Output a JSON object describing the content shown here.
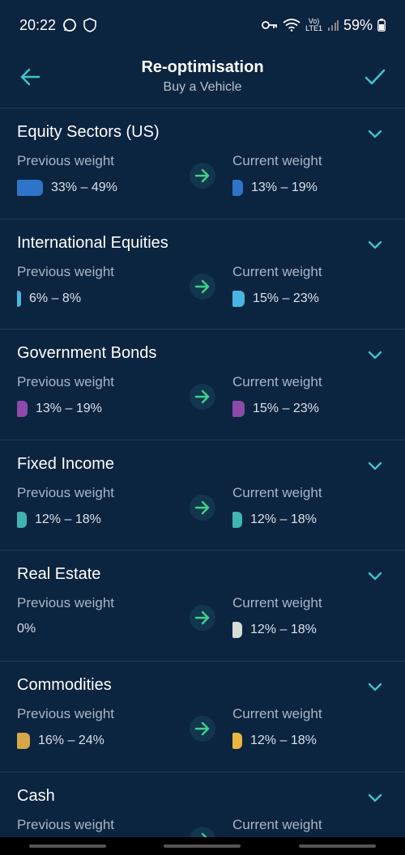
{
  "status_bar": {
    "time": "20:22",
    "network": "LTE1",
    "battery": "59%"
  },
  "header": {
    "title": "Re-optimisation",
    "subtitle": "Buy a Vehicle"
  },
  "labels": {
    "previous": "Previous weight",
    "current": "Current weight"
  },
  "rows": [
    {
      "title": "Equity Sectors (US)",
      "prev": "33% – 49%",
      "curr": "13% – 19%",
      "prev_color": "#2f74c8",
      "curr_color": "#2f74c8",
      "prev_fill": 0.49,
      "curr_fill": 0.19
    },
    {
      "title": "International Equities",
      "prev": "6% – 8%",
      "curr": "15% – 23%",
      "prev_color": "#47b6e0",
      "curr_color": "#47b6e0",
      "prev_fill": 0.08,
      "curr_fill": 0.23
    },
    {
      "title": "Government Bonds",
      "prev": "13% – 19%",
      "curr": "15% – 23%",
      "prev_color": "#8e4aa8",
      "curr_color": "#8e4aa8",
      "prev_fill": 0.19,
      "curr_fill": 0.23
    },
    {
      "title": "Fixed Income",
      "prev": "12% – 18%",
      "curr": "12% – 18%",
      "prev_color": "#3fb4b0",
      "curr_color": "#3fb4b0",
      "prev_fill": 0.18,
      "curr_fill": 0.18
    },
    {
      "title": "Real Estate",
      "prev": "0%",
      "curr": "12% – 18%",
      "prev_color": "",
      "curr_color": "#d5ddd5",
      "prev_fill": 0,
      "curr_fill": 0.18
    },
    {
      "title": "Commodities",
      "prev": "16% – 24%",
      "curr": "12% – 18%",
      "prev_color": "#d6a64a",
      "curr_color": "#e8b83e",
      "prev_fill": 0.24,
      "curr_fill": 0.18
    },
    {
      "title": "Cash",
      "prev": "",
      "curr": "",
      "prev_color": "",
      "curr_color": "",
      "prev_fill": 0,
      "curr_fill": 0
    }
  ],
  "colors": {
    "background": "#0b2440",
    "accent": "#3ec3c9",
    "arrow": "#3fd08a"
  }
}
